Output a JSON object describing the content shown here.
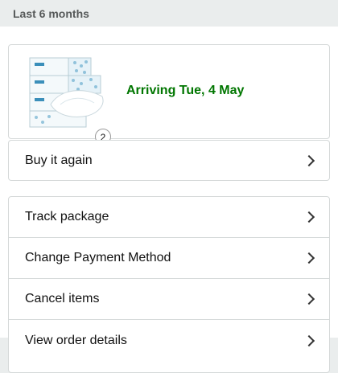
{
  "header": {
    "title": "Last 6 months"
  },
  "order": {
    "arrival": "Arriving Tue, 4 May",
    "quantity": "2",
    "product_icon": "tissue-box-product-image"
  },
  "buy_again": {
    "label": "Buy it again"
  },
  "actions": [
    {
      "label": "Track package"
    },
    {
      "label": "Change Payment Method"
    },
    {
      "label": "Cancel items"
    },
    {
      "label": "View order details"
    }
  ],
  "colors": {
    "arrival_green": "#007600",
    "border": "#d5d9d9",
    "background": "#eaeded"
  }
}
